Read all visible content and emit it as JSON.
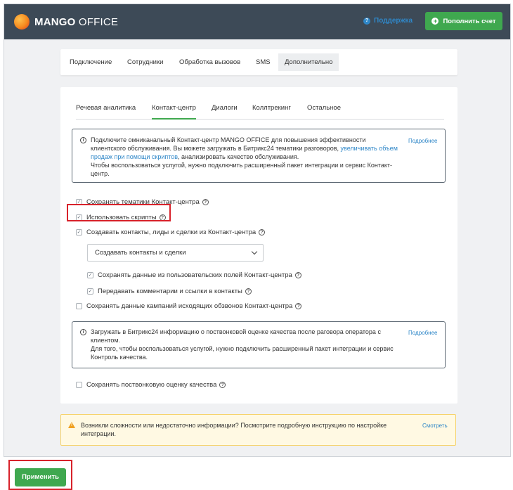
{
  "header": {
    "logo_bold": "MANGO",
    "logo_light": " OFFICE",
    "support_label": "Поддержка",
    "topup_label": "Пополнить счет"
  },
  "top_tabs": [
    {
      "label": "Подключение",
      "active": false
    },
    {
      "label": "Сотрудники",
      "active": false
    },
    {
      "label": "Обработка вызовов",
      "active": false
    },
    {
      "label": "SMS",
      "active": false
    },
    {
      "label": "Дополнительно",
      "active": true
    }
  ],
  "sub_tabs": [
    {
      "label": "Речевая аналитика",
      "active": false
    },
    {
      "label": "Контакт-центр",
      "active": true
    },
    {
      "label": "Диалоги",
      "active": false
    },
    {
      "label": "Коллтрекинг",
      "active": false
    },
    {
      "label": "Остальное",
      "active": false
    }
  ],
  "info1": {
    "text_before": "Подключите омниканальный Контакт-центр MANGO OFFICE для повышения эффективности клиентского обслуживания. Вы можете загружать в Битрикс24 тематики разговоров, ",
    "link_text": "увеличивать объем продаж при помощи скриптов",
    "text_after": ", анализировать качество обслуживания.",
    "line2": "Чтобы воспользоваться услугой, нужно подключить расширенный пакет интеграции и сервис Контакт-центр.",
    "more_label": "Подробнее"
  },
  "options": {
    "save_topics": {
      "label": "Сохранять тематики Контакт-центра",
      "checked": true
    },
    "use_scripts": {
      "label": "Использовать скрипты",
      "checked": true
    },
    "create_contacts": {
      "label": "Создавать контакты, лиды и сделки из Контакт-центра",
      "checked": true
    },
    "create_select_value": "Создавать контакты и сделки",
    "save_custom_fields": {
      "label": "Сохранять данные из пользовательских полей Контакт-центра",
      "checked": true
    },
    "pass_comments": {
      "label": "Передавать комментарии и ссылки в контакты",
      "checked": true
    },
    "save_outbound": {
      "label": "Сохранять данные кампаний исходящих обзвонов Контакт-центра",
      "checked": false
    },
    "save_quality": {
      "label": "Сохранять поствонковую оценку качества",
      "checked": false
    }
  },
  "info2": {
    "line1": "Загружать в Битрикс24 информацию о поствонковой оценке качества после раговора оператора с клиентом.",
    "line2": "Для того, чтобы воспользоваться услугой, нужно подключить расширенный пакет интеграции и сервис Контроль качества.",
    "more_label": "Подробнее"
  },
  "warning": {
    "text": "Возникли сложности или недостаточно информации? Посмотрите подробную инструкцию по настройке интеграции.",
    "link_label": "Смотреть"
  },
  "apply_label": "Применить",
  "colors": {
    "topbar": "#3d4a57",
    "accent_green": "#3fa84f",
    "link_blue": "#2f87c8",
    "highlight_red": "#d8222b",
    "warning_bg": "#fff9e3"
  }
}
